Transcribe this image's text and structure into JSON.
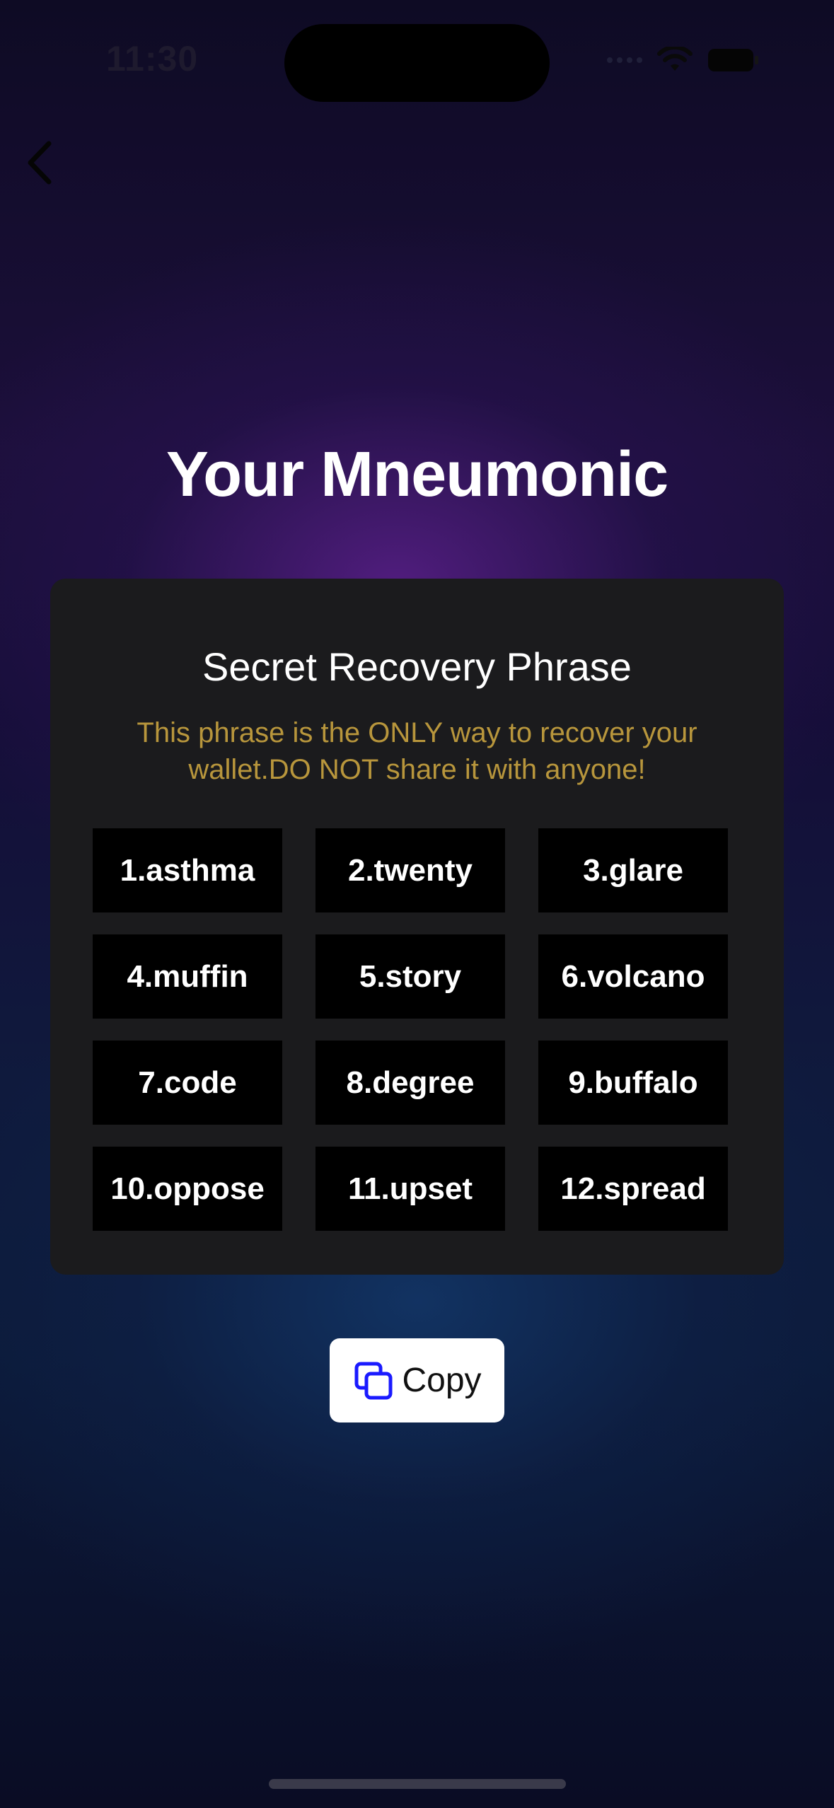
{
  "status_bar": {
    "time": "11:30"
  },
  "page": {
    "title": "Your Mneumonic"
  },
  "card": {
    "heading": "Secret Recovery Phrase",
    "warning": "This phrase is the ONLY way to recover your wallet.DO NOT share it with anyone!",
    "words": [
      "1.asthma",
      "2.twenty",
      "3.glare",
      "4.muffin",
      "5.story",
      "6.volcano",
      "7.code",
      "8.degree",
      "9.buffalo",
      "10.oppose",
      "11.upset",
      "12.spread"
    ]
  },
  "copy_button": {
    "label": "Copy",
    "icon": "copy-icon",
    "icon_color": "#1a1aff"
  },
  "colors": {
    "warning_text": "#b8963c",
    "card_background": "#1b1b1d",
    "chip_background": "#000000"
  }
}
